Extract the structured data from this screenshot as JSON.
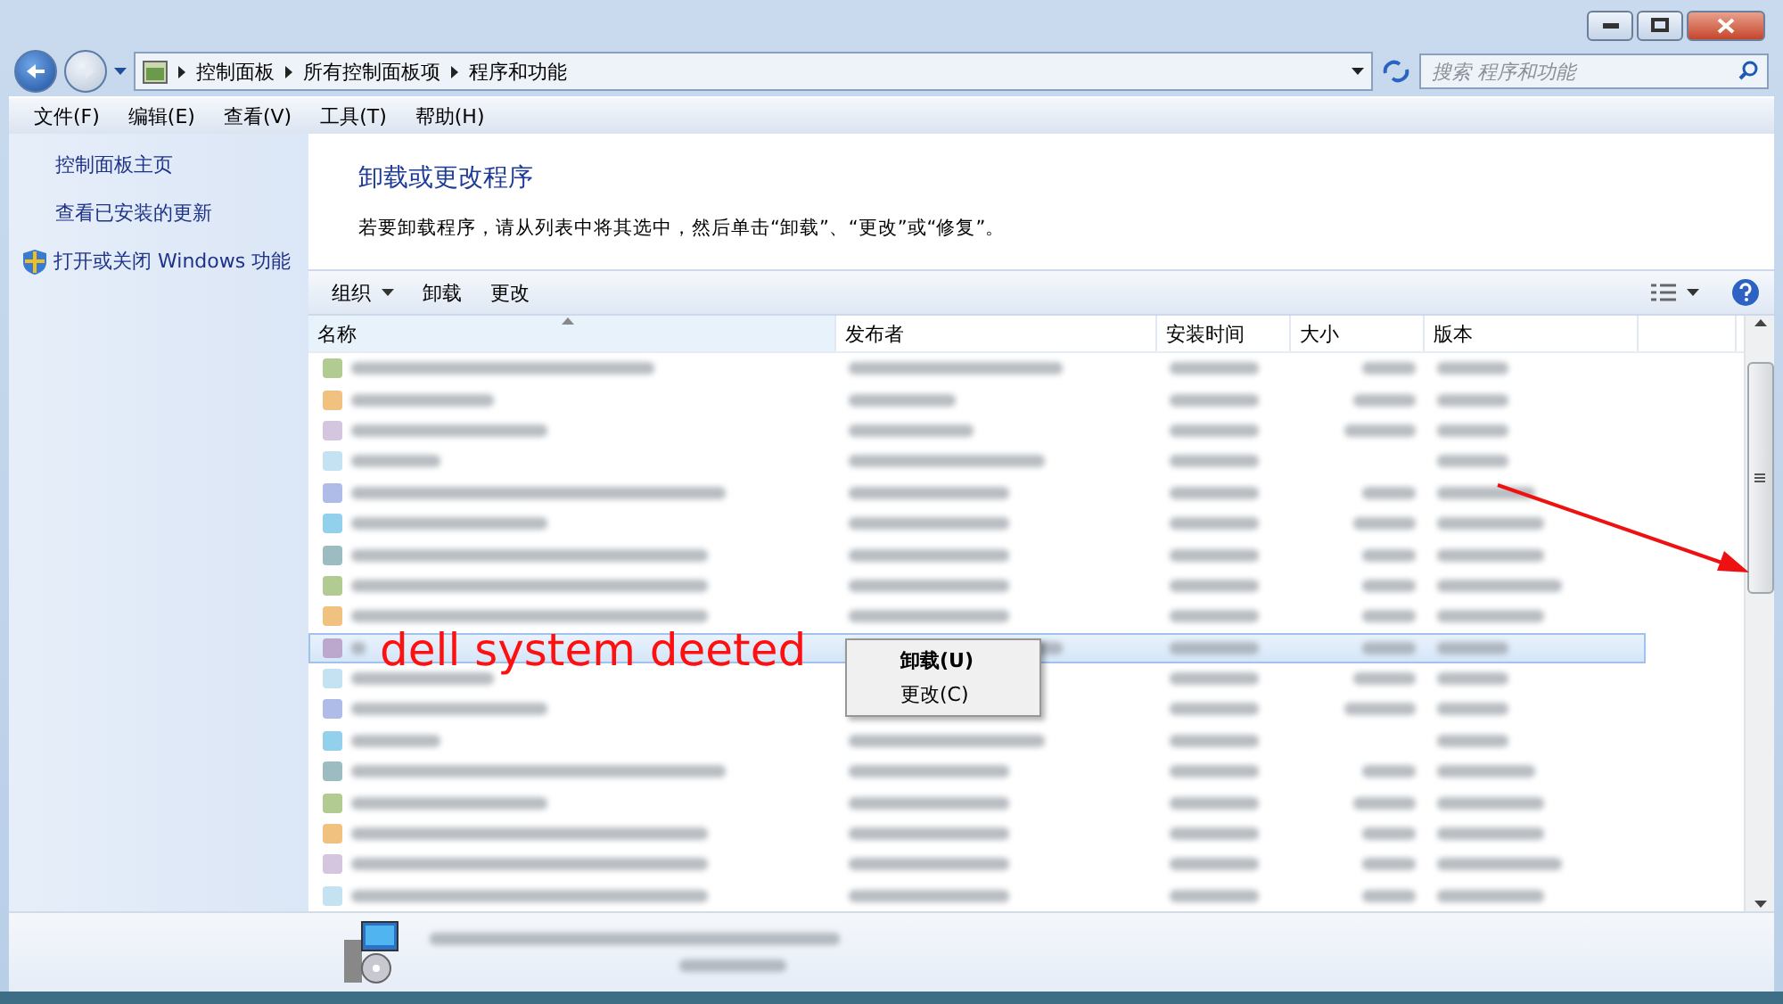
{
  "address_bar": {
    "breadcrumbs": [
      "控制面板",
      "所有控制面板项",
      "程序和功能"
    ]
  },
  "search": {
    "placeholder": "搜索 程序和功能"
  },
  "menu_bar": [
    "文件(F)",
    "编辑(E)",
    "查看(V)",
    "工具(T)",
    "帮助(H)"
  ],
  "sidebar": {
    "items": [
      {
        "label": "控制面板主页",
        "kind": "link"
      },
      {
        "label": "查看已安装的更新",
        "kind": "link"
      },
      {
        "label": "打开或关闭 Windows 功能",
        "kind": "shield"
      }
    ]
  },
  "heading": "卸载或更改程序",
  "description": "若要卸载程序，请从列表中将其选中，然后单击“卸载”、“更改”或“修复”。",
  "toolbar": [
    {
      "label": "组织",
      "dropdown": true
    },
    {
      "label": "卸载",
      "dropdown": false
    },
    {
      "label": "更改",
      "dropdown": false
    }
  ],
  "table": {
    "columns": [
      {
        "label": "名称",
        "sorted": true
      },
      {
        "label": "发布者",
        "sorted": false
      },
      {
        "label": "安装时间",
        "sorted": false
      },
      {
        "label": "大小",
        "sorted": false
      },
      {
        "label": "版本",
        "sorted": false
      }
    ],
    "rows": [
      {
        "selected": false
      },
      {
        "selected": false
      },
      {
        "selected": false
      },
      {
        "selected": false
      },
      {
        "selected": false
      },
      {
        "selected": false
      },
      {
        "selected": false
      },
      {
        "selected": false
      },
      {
        "selected": false
      },
      {
        "selected": true
      },
      {
        "selected": false
      },
      {
        "selected": false
      },
      {
        "selected": false
      },
      {
        "selected": false
      },
      {
        "selected": false
      },
      {
        "selected": false
      },
      {
        "selected": false
      },
      {
        "selected": false
      }
    ]
  },
  "context_menu": {
    "items": [
      {
        "label": "卸载(U)",
        "default": true
      },
      {
        "label": "更改(C)",
        "default": false
      }
    ]
  },
  "annotation": {
    "text": "dell system deeted"
  }
}
